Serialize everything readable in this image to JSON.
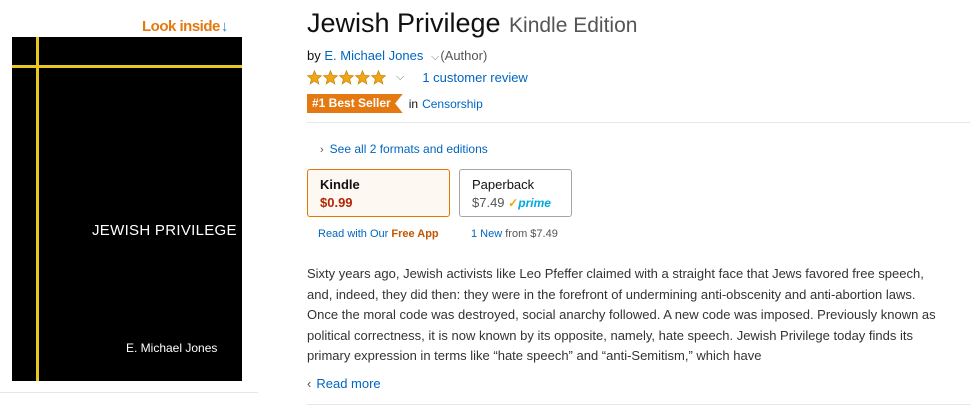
{
  "look_inside": {
    "label": "Look inside",
    "arrow": "↓"
  },
  "cover": {
    "title": "JEWISH PRIVILEGE",
    "author": "E. Michael Jones"
  },
  "product": {
    "title": "Jewish Privilege",
    "edition": "Kindle Edition",
    "by_label": "by",
    "author": "E. Michael Jones",
    "author_role": "(Author)",
    "rating": {
      "stars": 5,
      "max": 5,
      "reviews_label": "1 customer review",
      "star_color": "#f0a712"
    },
    "badge": "#1 Best Seller",
    "badge_in": "in",
    "category": "Censorship"
  },
  "formats": {
    "see_all": "See all 2 formats and editions",
    "kindle": {
      "name": "Kindle",
      "price": "$0.99",
      "sub_prefix": "Read with Our",
      "sub_bold": "Free App"
    },
    "paperback": {
      "name": "Paperback",
      "price": "$7.49",
      "prime": "prime",
      "new_label": "1 New",
      "from_label": "from $7.49"
    }
  },
  "description": {
    "text": "Sixty years ago, Jewish activists like Leo Pfeffer claimed with a straight face that Jews favored free speech, and, indeed, they did then: they were in the forefront of undermining anti-obscenity and anti-abortion laws. Once the moral code was destroyed, social anarchy followed. A new code was imposed. Previously known as political correctness, it is now known by its opposite, namely, hate speech. Jewish Privilege today finds its primary expression in terms like “hate speech” and “anti-Semitism,” which have",
    "read_more": "Read more"
  },
  "colors": {
    "accent_orange": "#e47911",
    "link_blue": "#0066c0",
    "price_red": "#b12704",
    "cover_line": "#e8c81f"
  }
}
